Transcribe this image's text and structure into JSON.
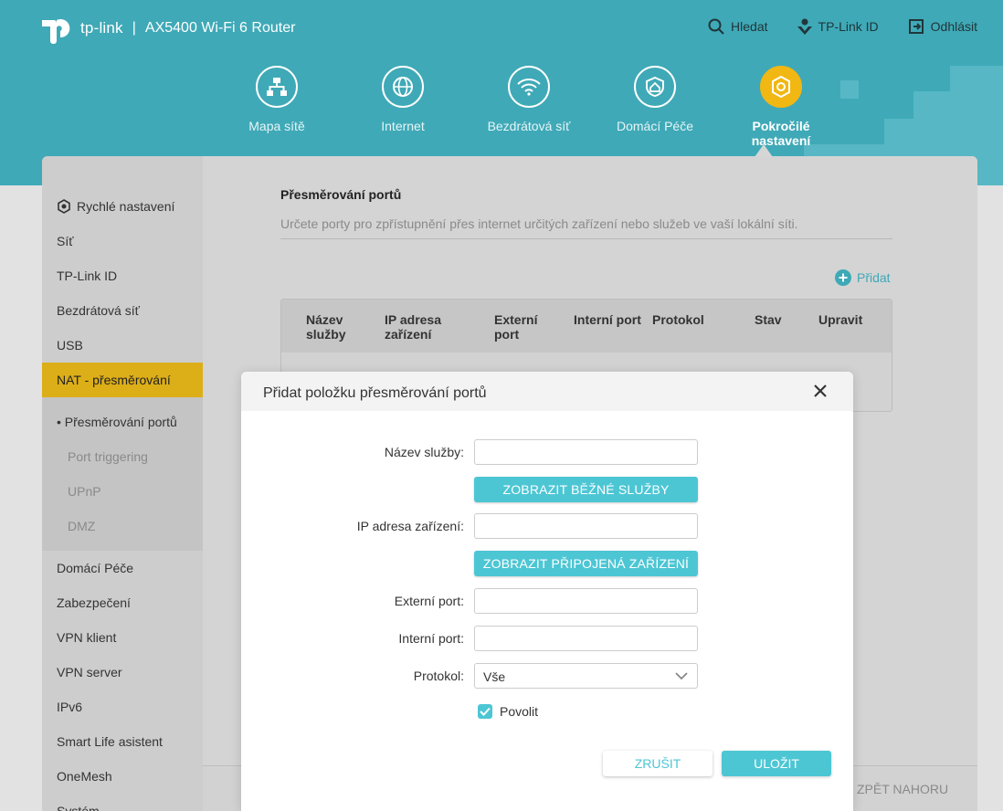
{
  "header": {
    "brand": "tp-link",
    "separator": "|",
    "model": "AX5400 Wi-Fi 6 Router",
    "links": [
      {
        "label": "Hledat",
        "icon": "search-icon"
      },
      {
        "label": "TP-Link ID",
        "icon": "tplink-id-icon"
      },
      {
        "label": "Odhlásit",
        "icon": "logout-icon"
      }
    ],
    "nav": [
      {
        "label": "Mapa sítě",
        "icon": "network-map-icon"
      },
      {
        "label": "Internet",
        "icon": "globe-icon"
      },
      {
        "label": "Bezdrátová síť",
        "icon": "wifi-icon"
      },
      {
        "label": "Domácí Péče",
        "icon": "home-shield-icon"
      },
      {
        "label": "Pokročilé nastavení",
        "icon": "advanced-gear-icon",
        "active": true
      }
    ]
  },
  "sidebar": {
    "items": [
      {
        "label": "Rychlé nastavení"
      },
      {
        "label": "Síť"
      },
      {
        "label": "TP-Link ID"
      },
      {
        "label": "Bezdrátová síť"
      },
      {
        "label": "USB"
      },
      {
        "label": "NAT - přesměrování"
      },
      {
        "label": "Domácí Péče"
      },
      {
        "label": "Zabezpečení"
      },
      {
        "label": "VPN klient"
      },
      {
        "label": "VPN server"
      },
      {
        "label": "IPv6"
      },
      {
        "label": "Smart Life asistent"
      },
      {
        "label": "OneMesh"
      },
      {
        "label": "Systém"
      }
    ],
    "sub_items": [
      {
        "label": "Přesměrování portů"
      },
      {
        "label": "Port triggering"
      },
      {
        "label": "UPnP"
      },
      {
        "label": "DMZ"
      }
    ]
  },
  "content": {
    "title": "Přesměrování portů",
    "description": "Určete porty pro zpřístupnění přes internet určitých zařízení nebo služeb ve vaší lokální síti.",
    "add_label": "Přidat",
    "columns": [
      "Název služby",
      "IP adresa zařízení",
      "Externí port",
      "Interní port",
      "Protokol",
      "Stav",
      "Upravit"
    ],
    "back_to_top": "ZPĚT NAHORU"
  },
  "modal": {
    "title": "Přidat položku přesměrování portů",
    "service_name_label": "Název služby:",
    "service_name_value": "",
    "show_services_label": "ZOBRAZIT BĚŽNÉ SLUŽBY",
    "device_ip_label": "IP adresa zařízení:",
    "device_ip_value": "",
    "show_devices_label": "ZOBRAZIT PŘIPOJENÁ ZAŘÍZENÍ",
    "external_port_label": "Externí port:",
    "external_port_value": "",
    "internal_port_label": "Interní port:",
    "internal_port_value": "",
    "protocol_label": "Protokol:",
    "protocol_value": "Vše",
    "enable_label": "Povolit",
    "enable_checked": true,
    "cancel_label": "ZRUŠIT",
    "save_label": "ULOŽIT"
  },
  "colors": {
    "header": "#3fa9b7",
    "accent": "#4dc6d4",
    "active_nav": "#f1b713",
    "sidebar_active": "#dcae18"
  }
}
